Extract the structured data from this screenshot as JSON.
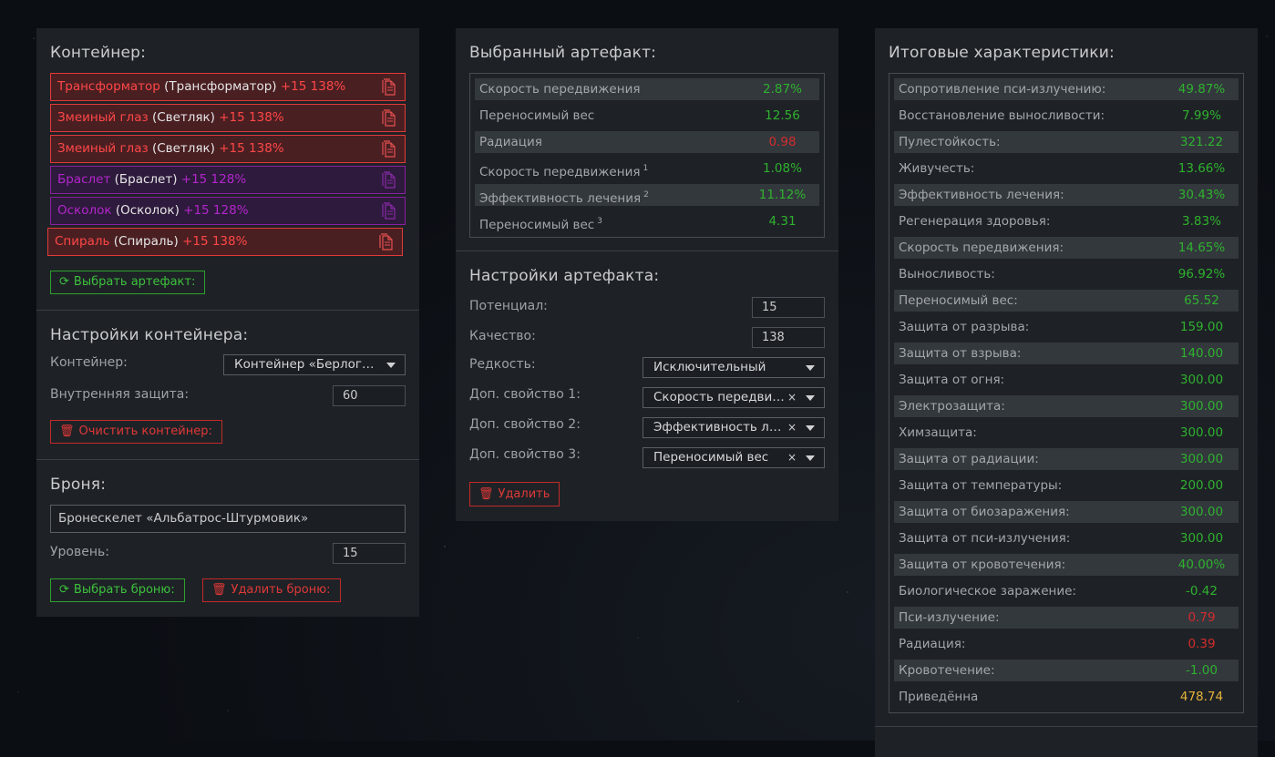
{
  "container_panel": {
    "title": "Контейнер:",
    "artifacts": [
      {
        "name": "Трансформатор",
        "sub": "(Трансформатор)",
        "bonus": "+15 138%",
        "color": "red"
      },
      {
        "name": "Змеиный глаз",
        "sub": "(Светляк)",
        "bonus": "+15 138%",
        "color": "red"
      },
      {
        "name": "Змеиный глаз",
        "sub": "(Светляк)",
        "bonus": "+15 138%",
        "color": "red"
      },
      {
        "name": "Браслет",
        "sub": "(Браслет)",
        "bonus": "+15 128%",
        "color": "purple"
      },
      {
        "name": "Осколок",
        "sub": "(Осколок)",
        "bonus": "+15 128%",
        "color": "purple"
      },
      {
        "name": "Спираль",
        "sub": "(Спираль)",
        "bonus": "+15 138%",
        "color": "red"
      }
    ],
    "choose_artifact_label": "Выбрать артефакт:"
  },
  "container_settings": {
    "title": "Настройки контейнера:",
    "container_label": "Контейнер:",
    "container_value": "Контейнер «Берлога…",
    "inner_protection_label": "Внутренняя защита:",
    "inner_protection_value": "60",
    "clear_label": "Очистить контейнер:"
  },
  "armor": {
    "title": "Броня:",
    "name_value": "Бронескелет «Альбатрос-Штурмовик»",
    "level_label": "Уровень:",
    "level_value": "15",
    "choose_label": "Выбрать броню:",
    "delete_label": "Удалить броню:"
  },
  "selected_artifact": {
    "title": "Выбранный артефакт:",
    "stats": [
      {
        "name": "Скорость передвижения",
        "sup": "",
        "value": "2.87%",
        "tone": "g"
      },
      {
        "name": "Переносимый вес",
        "sup": "",
        "value": "12.56",
        "tone": "g"
      },
      {
        "name": "Радиация",
        "sup": "",
        "value": "0.98",
        "tone": "r"
      },
      {
        "name": "Скорость передвижения",
        "sup": "1",
        "value": "1.08%",
        "tone": "g"
      },
      {
        "name": "Эффективность лечения",
        "sup": "2",
        "value": "11.12%",
        "tone": "g"
      },
      {
        "name": "Переносимый вес",
        "sup": "3",
        "value": "4.31",
        "tone": "g"
      }
    ]
  },
  "artifact_settings": {
    "title": "Настройки артефакта:",
    "potential_label": "Потенциал:",
    "potential_value": "15",
    "quality_label": "Качество:",
    "quality_value": "138",
    "rarity_label": "Редкость:",
    "rarity_value": "Исключительный",
    "extra1_label": "Доп. свойство 1:",
    "extra1_value": "Скорость передви…",
    "extra2_label": "Доп. свойство 2:",
    "extra2_value": "Эффективность ле…",
    "extra3_label": "Доп. свойство 3:",
    "extra3_value": "Переносимый вес",
    "clear_glyph": "×",
    "delete_label": "Удалить"
  },
  "totals": {
    "title": "Итоговые характеристики:",
    "stats": [
      {
        "name": "Сопротивление пси-излучению:",
        "value": "49.87%",
        "tone": "g"
      },
      {
        "name": "Восстановление выносливости:",
        "value": "7.99%",
        "tone": "g"
      },
      {
        "name": "Пулестойкость:",
        "value": "321.22",
        "tone": "g"
      },
      {
        "name": "Живучесть:",
        "value": "13.66%",
        "tone": "g"
      },
      {
        "name": "Эффективность лечения:",
        "value": "30.43%",
        "tone": "g"
      },
      {
        "name": "Регенерация здоровья:",
        "value": "3.83%",
        "tone": "g"
      },
      {
        "name": "Скорость передвижения:",
        "value": "14.65%",
        "tone": "g"
      },
      {
        "name": "Выносливость:",
        "value": "96.92%",
        "tone": "g"
      },
      {
        "name": "Переносимый вес:",
        "value": "65.52",
        "tone": "g"
      },
      {
        "name": "Защита от разрыва:",
        "value": "159.00",
        "tone": "g"
      },
      {
        "name": "Защита от взрыва:",
        "value": "140.00",
        "tone": "g"
      },
      {
        "name": "Защита от огня:",
        "value": "300.00",
        "tone": "g"
      },
      {
        "name": "Электрозащита:",
        "value": "300.00",
        "tone": "g"
      },
      {
        "name": "Химзащита:",
        "value": "300.00",
        "tone": "g"
      },
      {
        "name": "Защита от радиации:",
        "value": "300.00",
        "tone": "g"
      },
      {
        "name": "Защита от температуры:",
        "value": "200.00",
        "tone": "g"
      },
      {
        "name": "Защита от биозаражения:",
        "value": "300.00",
        "tone": "g"
      },
      {
        "name": "Защита от пси-излучения:",
        "value": "300.00",
        "tone": "g"
      },
      {
        "name": "Защита от кровотечения:",
        "value": "40.00%",
        "tone": "g"
      },
      {
        "name": "Биологическое заражение:",
        "value": "-0.42",
        "tone": "g"
      },
      {
        "name": "Пси-излучение:",
        "value": "0.79",
        "tone": "r"
      },
      {
        "name": "Радиация:",
        "value": "0.39",
        "tone": "r"
      },
      {
        "name": "Кровотечение:",
        "value": "-1.00",
        "tone": "g"
      },
      {
        "name": "Приведённа",
        "value": "478.74",
        "tone": "y"
      }
    ]
  },
  "colors": {
    "panel_bg": "#1e2226",
    "positive": "#2fb12f",
    "negative": "#d42c2c",
    "highlight": "#e5b13b",
    "artifact_red": "#ff4747",
    "artifact_purple": "#b226cc"
  }
}
